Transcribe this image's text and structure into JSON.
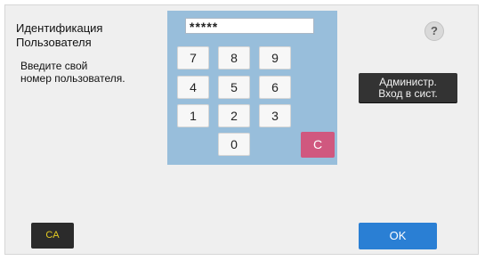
{
  "title": "Идентификация\nПользователя",
  "instruction": "Введите свой\nномер пользователя.",
  "pin_field": {
    "value": "*****"
  },
  "keypad": {
    "keys": [
      "7",
      "8",
      "9",
      "4",
      "5",
      "6",
      "1",
      "2",
      "3",
      "0"
    ],
    "clear_label": "C"
  },
  "help": {
    "label": "?"
  },
  "admin_button": {
    "label": "Администр.\nВход в сист."
  },
  "ca_button": {
    "label": "CA"
  },
  "ok_button": {
    "label": "OK"
  },
  "colors": {
    "keypad_bg": "#98bedb",
    "clear_key": "#d0587f",
    "ok_button": "#2a7fd4",
    "ca_text": "#e5cc22"
  }
}
